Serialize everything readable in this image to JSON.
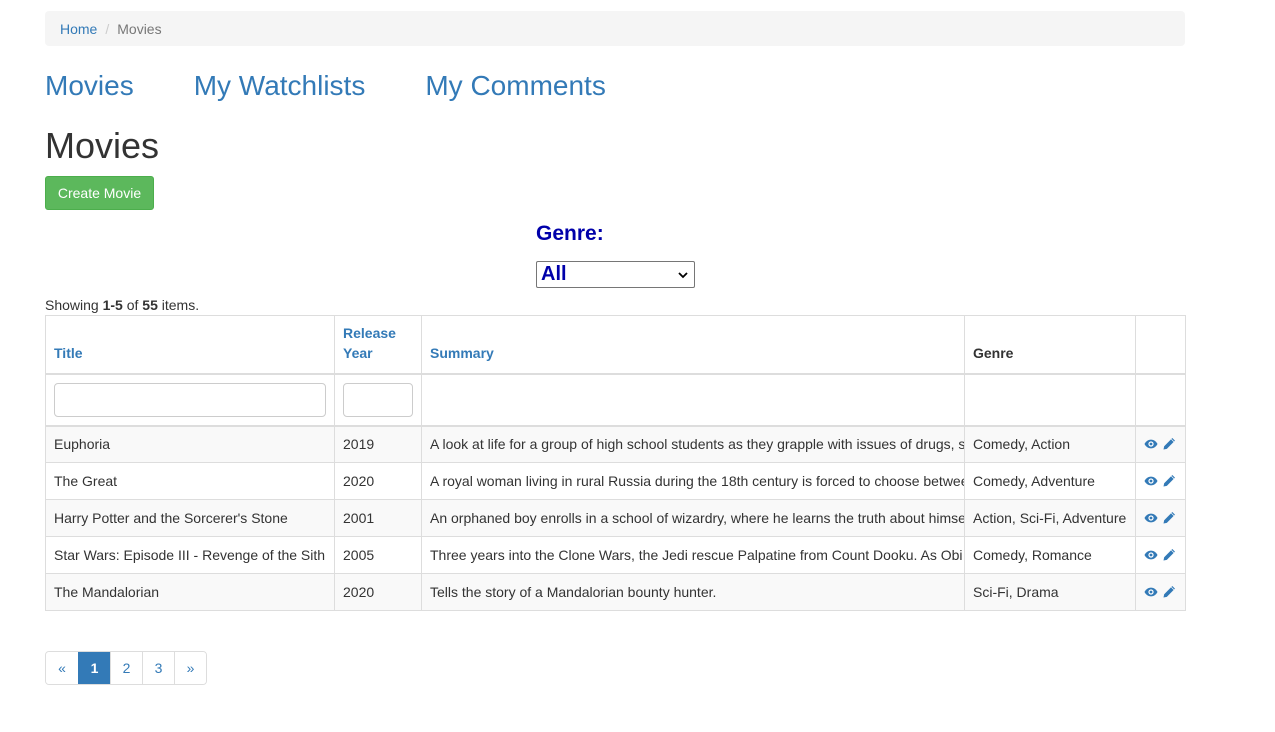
{
  "breadcrumb": {
    "home": "Home",
    "separator": "/",
    "current": "Movies"
  },
  "nav": {
    "movies": "Movies",
    "watchlists": "My Watchlists",
    "comments": "My Comments"
  },
  "page": {
    "title": "Movies",
    "create_button": "Create Movie"
  },
  "filter": {
    "genre_label": "Genre:",
    "genre_selected": "All"
  },
  "summary": {
    "prefix": "Showing ",
    "range": "1-5",
    "middle": " of ",
    "total": "55",
    "suffix": " items."
  },
  "table": {
    "headers": {
      "title": "Title",
      "release_year": "Release Year",
      "summary": "Summary",
      "genre": "Genre"
    },
    "filters": {
      "title": "",
      "release_year": ""
    },
    "rows": [
      {
        "title": "Euphoria",
        "year": "2019",
        "summary": "A look at life for a group of high school students as they grapple with issues of drugs, s",
        "genre": "Comedy, Action"
      },
      {
        "title": "The Great",
        "year": "2020",
        "summary": "A royal woman living in rural Russia during the 18th century is forced to choose betwee",
        "genre": "Comedy, Adventure"
      },
      {
        "title": "Harry Potter and the Sorcerer's Stone",
        "year": "2001",
        "summary": "An orphaned boy enrolls in a school of wizardry, where he learns the truth about himse",
        "genre": "Action, Sci-Fi, Adventure"
      },
      {
        "title": "Star Wars: Episode III - Revenge of the Sith",
        "year": "2005",
        "summary": "Three years into the Clone Wars, the Jedi rescue Palpatine from Count Dooku. As Obi",
        "genre": "Comedy, Romance"
      },
      {
        "title": "The Mandalorian",
        "year": "2020",
        "summary": "Tells the story of a Mandalorian bounty hunter.",
        "genre": "Sci-Fi, Drama"
      }
    ]
  },
  "pagination": {
    "prev": "«",
    "pages": [
      "1",
      "2",
      "3"
    ],
    "current": "1",
    "next": "»"
  },
  "colors": {
    "link": "#337ab7",
    "success": "#5cb85c",
    "genre_label": "#0000aa",
    "active_page": "#337ab7"
  },
  "icons": {
    "view": "eye-icon",
    "edit": "pencil-icon",
    "dropdown": "chevron-down-icon"
  }
}
